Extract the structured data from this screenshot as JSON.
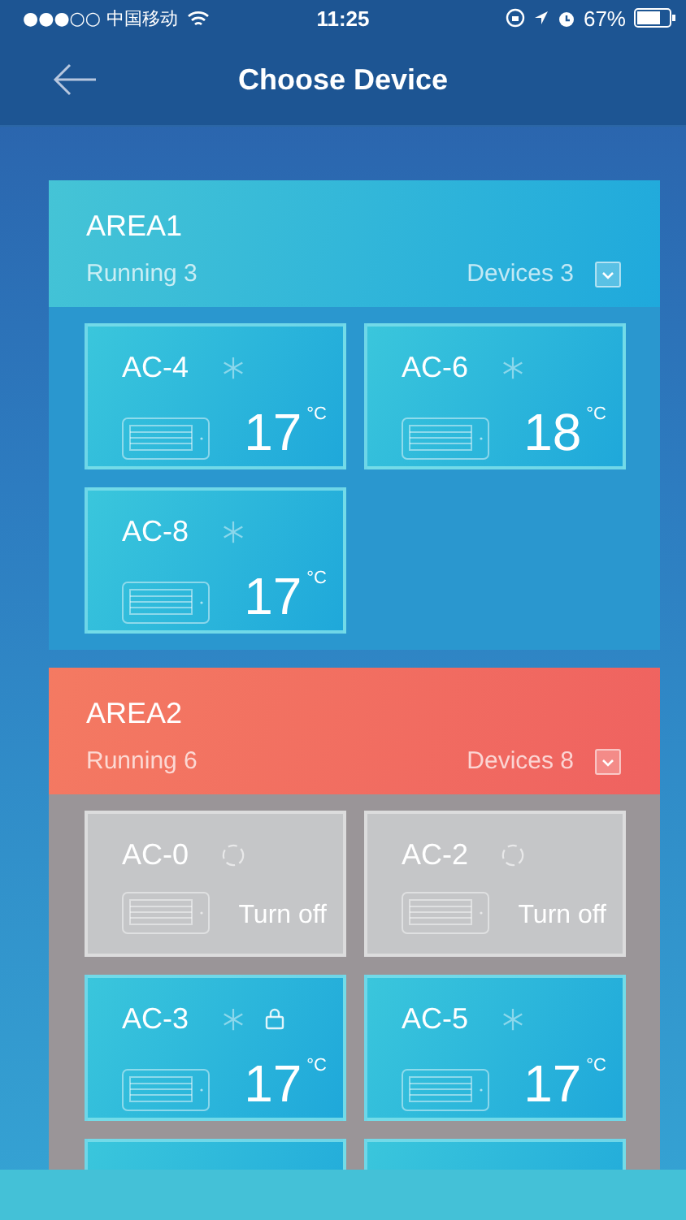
{
  "status_bar": {
    "carrier": "●●●○○ 中国移动",
    "time": "11:25",
    "battery": "67%"
  },
  "nav": {
    "title": "Choose Device"
  },
  "areas": [
    {
      "name": "AREA1",
      "running": "Running 3",
      "devices_count": "Devices 3",
      "alert": false,
      "expanded": true,
      "devices": [
        {
          "kind": "on",
          "name": "AC-4",
          "temperature": "17",
          "unit": "°C",
          "locked": false
        },
        {
          "kind": "on",
          "name": "AC-6",
          "temperature": "18",
          "unit": "°C",
          "locked": false
        },
        {
          "kind": "on",
          "name": "AC-8",
          "temperature": "17",
          "unit": "°C",
          "locked": false
        }
      ]
    },
    {
      "name": "AREA2",
      "running": "Running 6",
      "devices_count": "Devices 8",
      "alert": true,
      "expanded": true,
      "devices": [
        {
          "kind": "off",
          "name": "AC-0",
          "state": "Turn off"
        },
        {
          "kind": "off",
          "name": "AC-2",
          "state": "Turn off"
        },
        {
          "kind": "on",
          "name": "AC-3",
          "temperature": "17",
          "unit": "°C",
          "locked": true
        },
        {
          "kind": "on",
          "name": "AC-5",
          "temperature": "17",
          "unit": "°C",
          "locked": false
        },
        {
          "kind": "hidden"
        },
        {
          "kind": "hidden"
        }
      ]
    }
  ]
}
